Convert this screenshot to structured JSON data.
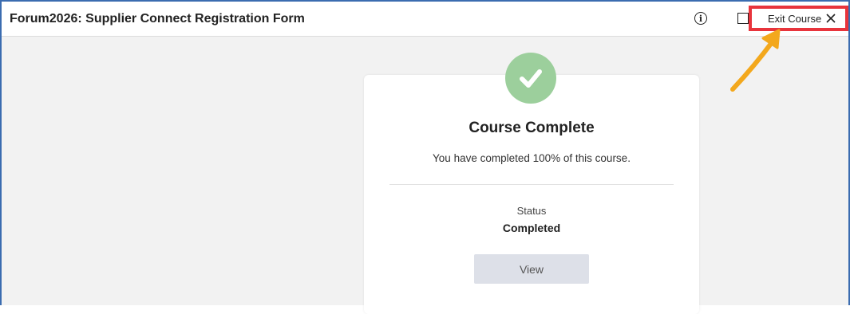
{
  "header": {
    "title": "Forum2026: Supplier Connect Registration Form",
    "info_icon": "info-circle-icon",
    "window_icon": "square-icon",
    "exit_label": "Exit Course",
    "exit_icon": "close-icon"
  },
  "annotation": {
    "highlight_color": "#e8343c",
    "arrow_color": "#f3a81d"
  },
  "completion": {
    "icon": "check-icon",
    "icon_color": "#9ccf9c",
    "title": "Course Complete",
    "message": "You have completed 100% of this course.",
    "progress_percent": 100,
    "status_label": "Status",
    "status_value": "Completed",
    "view_label": "View"
  },
  "colors": {
    "frame_border": "#3b6cb0",
    "background": "#f2f2f2"
  }
}
